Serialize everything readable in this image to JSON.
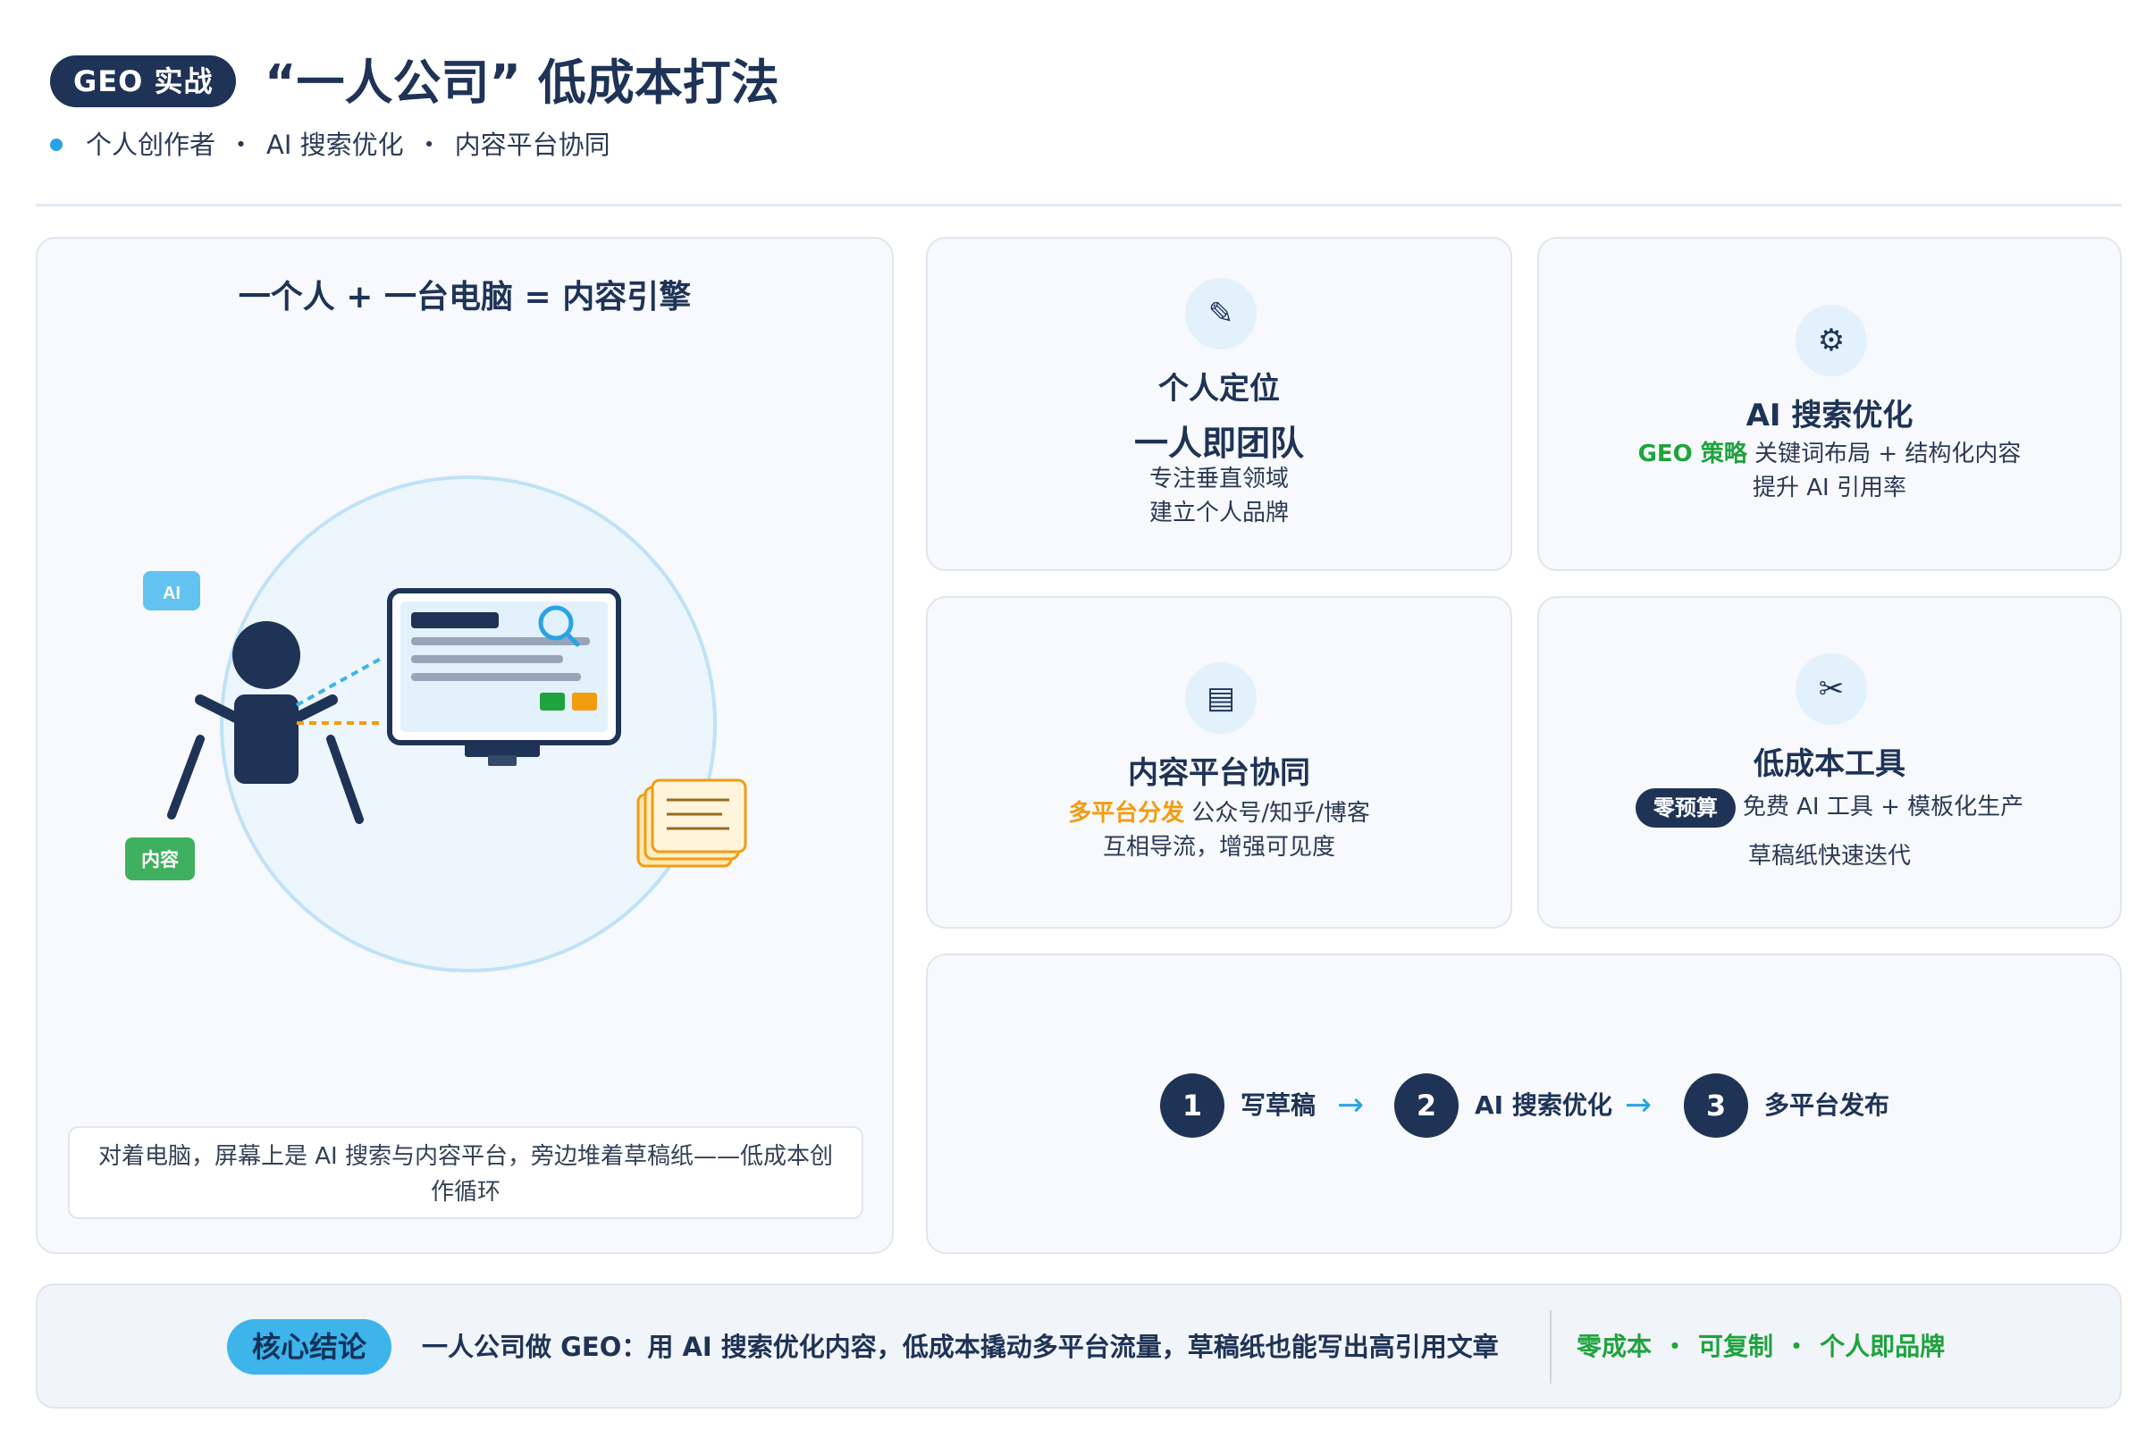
{
  "header": {
    "badge": "GEO 实战",
    "title": "“一人公司” 低成本打法",
    "subtitle_items": [
      "个人创作者",
      "AI 搜索优化",
      "内容平台协同"
    ],
    "subtitle_separator": "・"
  },
  "illustration_card": {
    "title": "一个人 + 一台电脑 = 内容引擎",
    "tag_ai": "AI",
    "tag_content": "内容",
    "caption": "对着电脑，屏幕上是 AI 搜索与内容平台，旁边堆着草稿纸——低成本创作循环"
  },
  "cards": {
    "positioning": {
      "icon": "pencil-icon",
      "title": "个人定位",
      "headline": "一人即团队",
      "lines": [
        "专注垂直领域",
        "建立个人品牌"
      ]
    },
    "ai_search": {
      "icon": "gear-icon",
      "title": "AI 搜索优化",
      "highlight": "GEO 策略",
      "line1_rest": "关键词布局 + 结构化内容",
      "line2": "提升 AI 引用率"
    },
    "platform": {
      "icon": "document-icon",
      "title": "内容平台协同",
      "highlight": "多平台分发",
      "line1_rest": "公众号/知乎/博客",
      "line2": "互相导流，增强可见度"
    },
    "tools": {
      "icon": "scissors-icon",
      "title": "低成本工具",
      "badge": "零预算",
      "line1_rest": "免费 AI 工具 + 模板化生产",
      "line2": "草稿纸快速迭代"
    }
  },
  "steps": [
    {
      "num": "1",
      "label": "写草稿"
    },
    {
      "num": "2",
      "label": "AI 搜索优化"
    },
    {
      "num": "3",
      "label": "多平台发布"
    }
  ],
  "step_arrow": "→",
  "conclusion": {
    "label": "核心结论",
    "text": "一人公司做 GEO：用 AI 搜索优化内容，低成本撬动多平台流量，草稿纸也能写出高引用文章",
    "tags": [
      "零成本",
      "可复制",
      "个人即品牌"
    ],
    "tag_separator": "・"
  },
  "colors": {
    "navy": "#1e3356",
    "accent_blue": "#29a3e6",
    "green": "#1fa33e",
    "orange": "#f29c11",
    "light_blue": "#e3f1fc"
  }
}
